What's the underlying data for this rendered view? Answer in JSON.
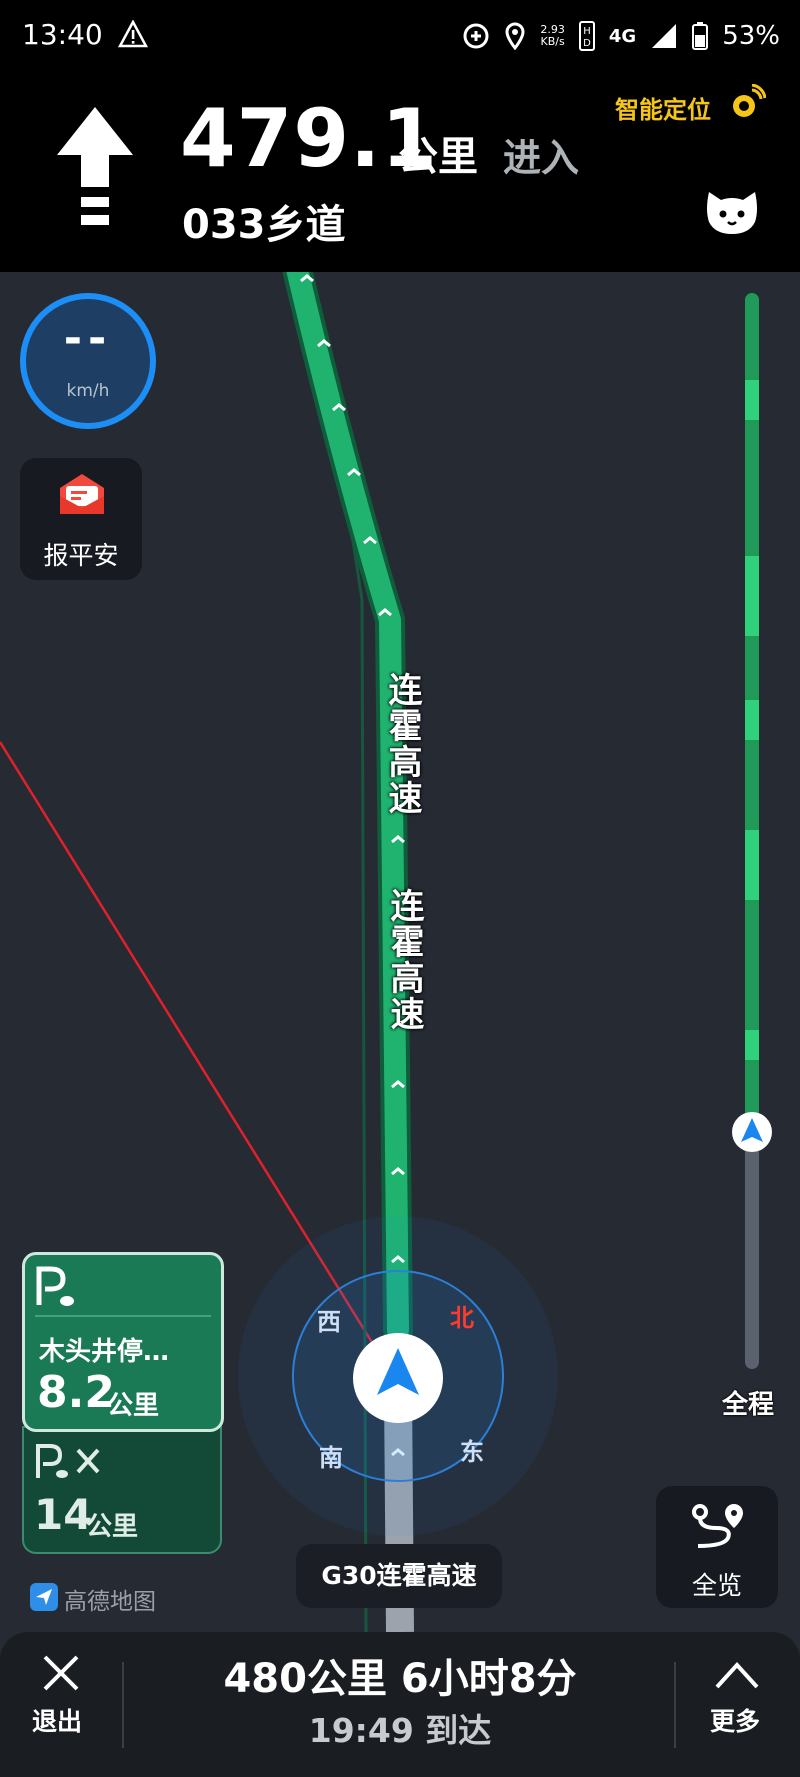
{
  "status_bar": {
    "time": "13:40",
    "net_speed_value": "2.93",
    "net_speed_unit": "KB/s",
    "network": "4G",
    "battery": "53%"
  },
  "nav_header": {
    "distance": "479.1",
    "distance_unit": "公里",
    "action": "进入",
    "road": "033乡道",
    "smart_location": "智能定位",
    "direction_icon": "straight-arrow"
  },
  "speed": {
    "value": "--",
    "unit": "km/h"
  },
  "safety_button": {
    "label": "报平安"
  },
  "map": {
    "road_labels": [
      "连霍高速",
      "连霍高速"
    ],
    "compass": {
      "north": "北",
      "south": "南",
      "east": "东",
      "west": "西"
    },
    "current_road": "G30连霍高速",
    "brand": "高德地图",
    "route_color": "#1fb36f",
    "accent_color": "#1d8ef5"
  },
  "progress_rail": {
    "label": "全程",
    "position": 0.5
  },
  "parking_cards": [
    {
      "name": "木头井停…",
      "distance": "8.2",
      "unit": "公里"
    },
    {
      "distance": "14",
      "unit": "公里"
    }
  ],
  "overview_button": {
    "label": "全览"
  },
  "bottom_bar": {
    "exit_label": "退出",
    "summary": "480公里 6小时8分",
    "eta": "19:49 到达",
    "more_label": "更多"
  }
}
